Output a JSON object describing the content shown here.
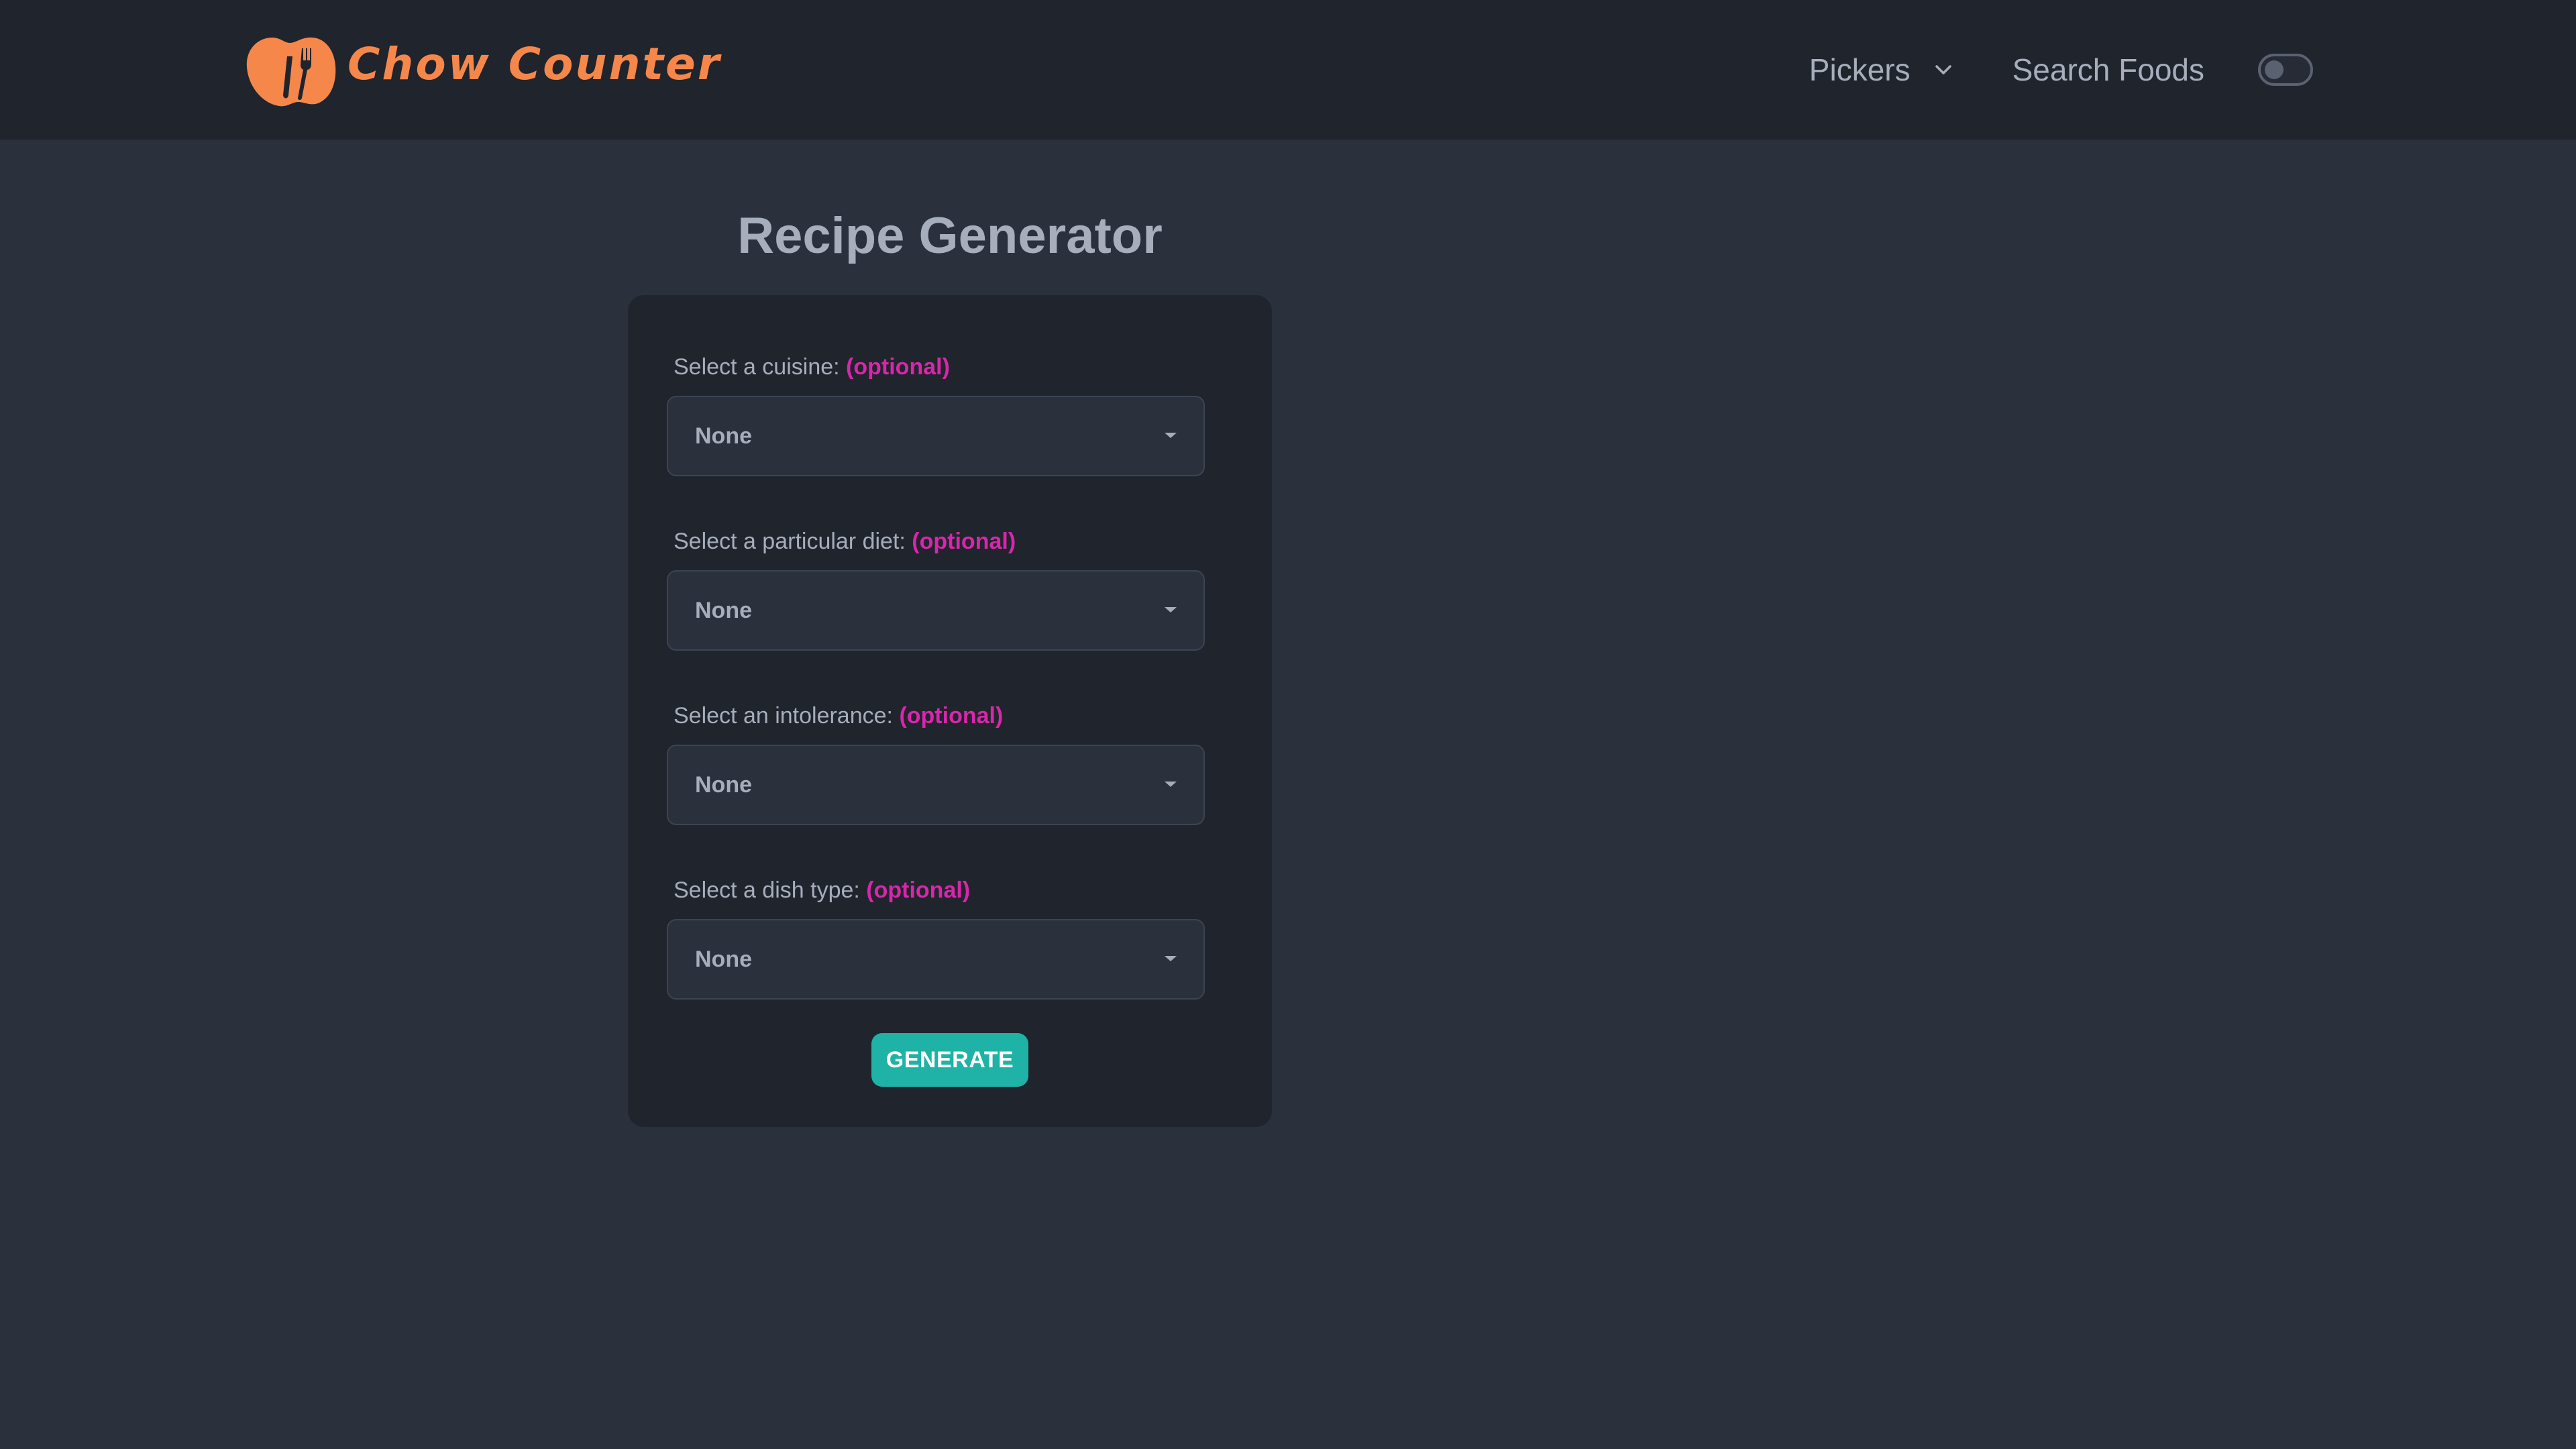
{
  "navbar": {
    "brand": "Chow Counter",
    "pickers_label": "Pickers",
    "search_label": "Search Foods",
    "theme_toggle_on": false
  },
  "main": {
    "title": "Recipe Generator",
    "optional_text": "(optional)",
    "fields": [
      {
        "label": "Select a cuisine:",
        "value": "None"
      },
      {
        "label": "Select a particular diet:",
        "value": "None"
      },
      {
        "label": "Select an intolerance:",
        "value": "None"
      },
      {
        "label": "Select a dish type:",
        "value": "None"
      }
    ],
    "generate_label": "GENERATE"
  },
  "colors": {
    "background": "#2a303c",
    "navbar": "#1f242d",
    "brand": "#f6874b",
    "text": "#a6adbb",
    "optional": "#d926aa",
    "primary_button": "#1fb2a6"
  },
  "icons": {
    "logo": "chow-counter-logo",
    "pickers_dropdown": "chevron-down-icon",
    "select_caret": "caret-down-icon"
  }
}
